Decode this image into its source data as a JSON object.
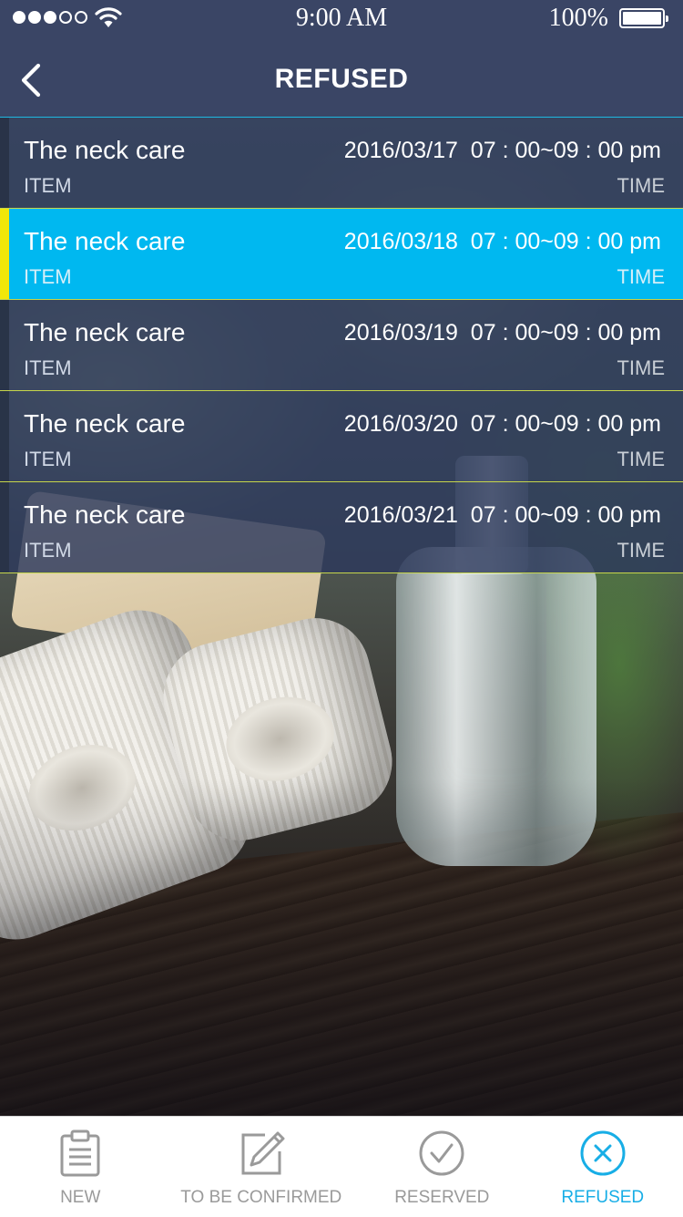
{
  "status_bar": {
    "time": "9:00 AM",
    "battery": "100%",
    "signal_bars": 3,
    "signal_total": 5
  },
  "header": {
    "title": "REFUSED",
    "back_icon": "chevron-left-icon"
  },
  "appointments": [
    {
      "item": "The neck care",
      "item_label": "ITEM",
      "when": "2016/03/17  07 : 00~09 : 00 pm",
      "time_label": "TIME",
      "selected": false
    },
    {
      "item": "The neck care",
      "item_label": "ITEM",
      "when": "2016/03/18  07 : 00~09 : 00 pm",
      "time_label": "TIME",
      "selected": true
    },
    {
      "item": "The neck care",
      "item_label": "ITEM",
      "when": "2016/03/19  07 : 00~09 : 00 pm",
      "time_label": "TIME",
      "selected": false
    },
    {
      "item": "The neck care",
      "item_label": "ITEM",
      "when": "2016/03/20  07 : 00~09 : 00 pm",
      "time_label": "TIME",
      "selected": false
    },
    {
      "item": "The neck care",
      "item_label": "ITEM",
      "when": "2016/03/21  07 : 00~09 : 00 pm",
      "time_label": "TIME",
      "selected": false
    }
  ],
  "tabbar": {
    "tabs": [
      {
        "label": "NEW",
        "icon": "clipboard-icon",
        "selected": false
      },
      {
        "label": "TO BE CONFIRMED",
        "icon": "edit-icon",
        "selected": false
      },
      {
        "label": "RESERVED",
        "icon": "check-circle-icon",
        "selected": false
      },
      {
        "label": "REFUSED",
        "icon": "close-circle-icon",
        "selected": true
      }
    ]
  },
  "colors": {
    "header_bg": "#3a4565",
    "row_bg": "#2c385c",
    "row_selected_bg": "#00b8f0",
    "selected_marker": "#f1e70a",
    "row_divider": "#c7d64a",
    "tab_active": "#18aee6",
    "tab_inactive": "#9a9a9a"
  }
}
